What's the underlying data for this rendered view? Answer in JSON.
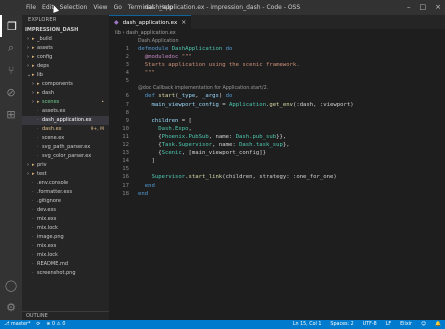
{
  "window": {
    "title": "dash_application.ex - impression_dash - Code - OSS",
    "menu": [
      "File",
      "Edit",
      "Selection",
      "View",
      "Go",
      "Terminal",
      "Help"
    ]
  },
  "activity_bar": {
    "icons": [
      "files-icon",
      "search-icon",
      "source-control-icon",
      "debug-icon",
      "extensions-icon"
    ],
    "bottom_icons": [
      "account-icon",
      "gear-icon"
    ]
  },
  "sidebar": {
    "header": "EXPLORER",
    "project": "IMPRESSION_DASH",
    "items": [
      {
        "label": "_build",
        "depth": 1,
        "twisty": "›",
        "icon": "folder",
        "color": "#cccccc"
      },
      {
        "label": "assets",
        "depth": 1,
        "twisty": "›",
        "icon": "folder",
        "color": "#cccccc"
      },
      {
        "label": "config",
        "depth": 1,
        "twisty": "›",
        "icon": "folder",
        "color": "#cccccc"
      },
      {
        "label": "deps",
        "depth": 1,
        "twisty": "›",
        "icon": "folder",
        "color": "#cccccc"
      },
      {
        "label": "lib",
        "depth": 1,
        "twisty": "⌄",
        "icon": "folder",
        "color": "#cccccc"
      },
      {
        "label": "components",
        "depth": 2,
        "twisty": "›",
        "icon": "folder",
        "color": "#cccccc"
      },
      {
        "label": "dash",
        "depth": 2,
        "twisty": "›",
        "icon": "folder",
        "color": "#cccccc"
      },
      {
        "label": "scenes",
        "depth": 2,
        "twisty": "›",
        "icon": "folder",
        "color": "#73c991",
        "badge": "•"
      },
      {
        "label": "assets.ex",
        "depth": 2,
        "twisty": "",
        "icon": "file",
        "color": "#cccccc"
      },
      {
        "label": "dash_application.ex",
        "depth": 2,
        "twisty": "",
        "icon": "file",
        "color": "#ffffff",
        "selected": true
      },
      {
        "label": "dash.ex",
        "depth": 2,
        "twisty": "",
        "icon": "file",
        "color": "#e2c08d",
        "badge": "9+, M"
      },
      {
        "label": "scene.ex",
        "depth": 2,
        "twisty": "",
        "icon": "file",
        "color": "#cccccc"
      },
      {
        "label": "svg_path_parser.ex",
        "depth": 2,
        "twisty": "",
        "icon": "file",
        "color": "#cccccc"
      },
      {
        "label": "svg_color_parser.ex",
        "depth": 2,
        "twisty": "",
        "icon": "file",
        "color": "#cccccc"
      },
      {
        "label": "priv",
        "depth": 1,
        "twisty": "›",
        "icon": "folder",
        "color": "#cccccc"
      },
      {
        "label": "test",
        "depth": 1,
        "twisty": "›",
        "icon": "folder",
        "color": "#cccccc"
      },
      {
        "label": ".env.console",
        "depth": 1,
        "twisty": "",
        "icon": "file",
        "color": "#cccccc"
      },
      {
        "label": ".formatter.exs",
        "depth": 1,
        "twisty": "",
        "icon": "file",
        "color": "#cccccc"
      },
      {
        "label": ".gitignore",
        "depth": 1,
        "twisty": "",
        "icon": "file",
        "color": "#cccccc"
      },
      {
        "label": "dev.exs",
        "depth": 1,
        "twisty": "",
        "icon": "file",
        "color": "#cccccc"
      },
      {
        "label": "mix.exs",
        "depth": 1,
        "twisty": "",
        "icon": "file",
        "color": "#cccccc"
      },
      {
        "label": "mix.lock",
        "depth": 1,
        "twisty": "",
        "icon": "file",
        "color": "#cccccc"
      },
      {
        "label": "image.png",
        "depth": 1,
        "twisty": "",
        "icon": "file",
        "color": "#cccccc"
      },
      {
        "label": "mix.exs",
        "depth": 1,
        "twisty": "",
        "icon": "file",
        "color": "#cccccc"
      },
      {
        "label": "mix.lock",
        "depth": 1,
        "twisty": "",
        "icon": "file",
        "color": "#cccccc"
      },
      {
        "label": "README.md",
        "depth": 1,
        "twisty": "",
        "icon": "file",
        "color": "#cccccc"
      },
      {
        "label": "screenshot.png",
        "depth": 1,
        "twisty": "",
        "icon": "file",
        "color": "#cccccc"
      }
    ],
    "outline": "OUTLINE"
  },
  "editor": {
    "tab": {
      "label": "dash_application.ex",
      "close": "×"
    },
    "breadcrumb": "lib › dash_application.ex",
    "lens_top": "Dash.Application",
    "lens_mid": "@doc Callback implementation for Application.start/2.",
    "lines": [
      {
        "n": "1",
        "t": [
          [
            "k",
            "defmodule "
          ],
          [
            "m",
            "DashApplication"
          ],
          [
            "k",
            " do"
          ]
        ]
      },
      {
        "n": "2",
        "t": [
          [
            "p",
            "  @moduledoc "
          ],
          [
            "s",
            "\"\"\""
          ]
        ]
      },
      {
        "n": "3",
        "t": [
          [
            "s",
            "  Starts application using the scenic framework."
          ]
        ]
      },
      {
        "n": "4",
        "t": [
          [
            "s",
            "  \"\"\""
          ]
        ]
      },
      {
        "n": "5",
        "t": [
          [
            "src",
            ""
          ]
        ]
      },
      {
        "n": "6",
        "t": [
          [
            "k",
            "  def "
          ],
          [
            "f",
            "start"
          ],
          [
            "src",
            "("
          ],
          [
            "a",
            "_type"
          ],
          [
            "src",
            ", "
          ],
          [
            "a",
            "_args"
          ],
          [
            "src",
            ") "
          ],
          [
            "k",
            "do"
          ]
        ]
      },
      {
        "n": "7",
        "t": [
          [
            "src",
            "    "
          ],
          [
            "a",
            "main_viewport_config"
          ],
          [
            "src",
            " = "
          ],
          [
            "m",
            "Application"
          ],
          [
            "src",
            "."
          ],
          [
            "f",
            "get_env"
          ],
          [
            "src",
            "(:dash, :viewport)"
          ]
        ]
      },
      {
        "n": "8",
        "t": [
          [
            "src",
            ""
          ]
        ]
      },
      {
        "n": "9",
        "t": [
          [
            "src",
            "    "
          ],
          [
            "a",
            "children"
          ],
          [
            "src",
            " = ["
          ]
        ]
      },
      {
        "n": "10",
        "t": [
          [
            "src",
            "      "
          ],
          [
            "m",
            "Dash.Expo"
          ],
          [
            "src",
            ","
          ]
        ]
      },
      {
        "n": "11",
        "t": [
          [
            "src",
            "      {"
          ],
          [
            "m",
            "Phoenix.PubSub"
          ],
          [
            "src",
            ", name: "
          ],
          [
            "m",
            "Dash.pub_sub"
          ],
          [
            "src",
            "}},"
          ]
        ]
      },
      {
        "n": "12",
        "t": [
          [
            "src",
            "      {"
          ],
          [
            "m",
            "Task.Supervisor"
          ],
          [
            "src",
            ", name: "
          ],
          [
            "m",
            "Dash.task_sup"
          ],
          [
            "src",
            "},"
          ]
        ]
      },
      {
        "n": "13",
        "t": [
          [
            "src",
            "      {"
          ],
          [
            "m",
            "Scenic"
          ],
          [
            "src",
            ", [main_viewport_config]}"
          ]
        ]
      },
      {
        "n": "14",
        "t": [
          [
            "src",
            "    ]"
          ]
        ]
      },
      {
        "n": "15",
        "t": [
          [
            "src",
            ""
          ]
        ]
      },
      {
        "n": "16",
        "t": [
          [
            "src",
            "    "
          ],
          [
            "m",
            "Supervisor"
          ],
          [
            "src",
            "."
          ],
          [
            "f",
            "start_link"
          ],
          [
            "src",
            "(children, strategy: :one_for_one)"
          ]
        ]
      },
      {
        "n": "17",
        "t": [
          [
            "k",
            "  end"
          ]
        ]
      },
      {
        "n": "18",
        "t": [
          [
            "k",
            "end"
          ]
        ]
      }
    ]
  },
  "status": {
    "left": [
      "⎇ master*",
      "⟳",
      "⊗ 0 ⚠ 0"
    ],
    "right": [
      "Ln 15, Col 1",
      "Spaces: 2",
      "UTF-8",
      "LF",
      "Elixir",
      "☺",
      "🔔"
    ]
  },
  "colors": {
    "accent": "#007acc",
    "keyword": "#569cd6",
    "module": "#4ec9b0",
    "string": "#ce9178",
    "function": "#dcdcaa"
  }
}
